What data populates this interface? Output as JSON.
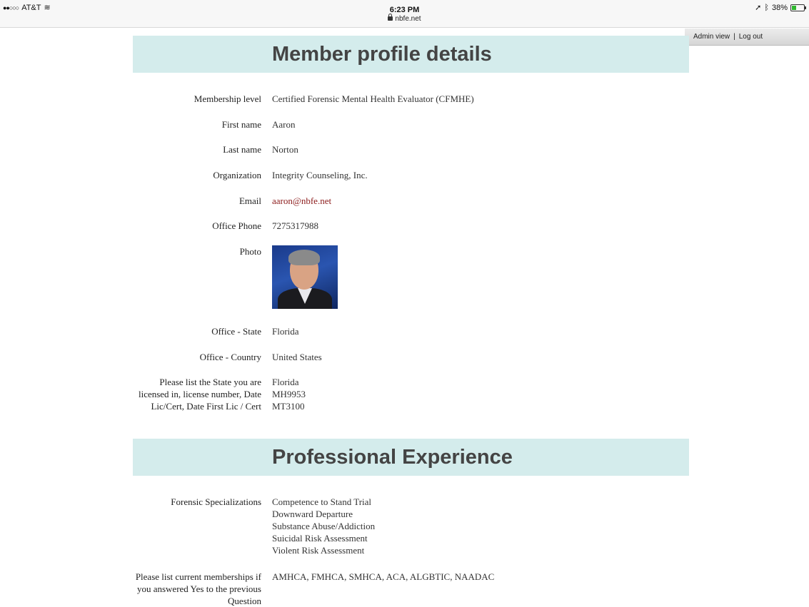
{
  "status_bar": {
    "carrier": "AT&T",
    "time": "6:23 PM",
    "url": "nbfe.net",
    "battery": "38%",
    "battery_level": 0.38
  },
  "admin_bar": {
    "admin_view": "Admin view",
    "separator": "|",
    "logout": "Log out"
  },
  "sections": {
    "profile_title": "Member profile details",
    "experience_title": "Professional Experience"
  },
  "profile": {
    "membership_level": {
      "label": "Membership level",
      "value": "Certified Forensic Mental Health Evaluator (CFMHE)"
    },
    "first_name": {
      "label": "First name",
      "value": "Aaron"
    },
    "last_name": {
      "label": "Last name",
      "value": "Norton"
    },
    "organization": {
      "label": "Organization",
      "value": "Integrity Counseling, Inc."
    },
    "email": {
      "label": "Email",
      "value": "aaron@nbfe.net"
    },
    "office_phone": {
      "label": "Office Phone",
      "value": "7275317988"
    },
    "photo": {
      "label": "Photo"
    },
    "office_state": {
      "label": "Office - State",
      "value": "Florida"
    },
    "office_country": {
      "label": "Office - Country",
      "value": "United States"
    },
    "license": {
      "label": "Please list the State you are licensed in, license number, Date Lic/Cert, Date First Lic / Cert",
      "lines": [
        "Florida",
        "MH9953",
        "MT3100"
      ]
    }
  },
  "experience": {
    "specializations": {
      "label": "Forensic Specializations",
      "lines": [
        "Competence to Stand Trial",
        "Downward Departure",
        "Substance Abuse/Addiction",
        "Suicidal Risk Assessment",
        "Violent Risk Assessment"
      ]
    },
    "memberships": {
      "label": "Please list current memberships if you answered Yes to the previous Question",
      "value": "AMHCA, FMHCA, SMHCA, ACA, ALGBTIC, NAADAC"
    }
  }
}
